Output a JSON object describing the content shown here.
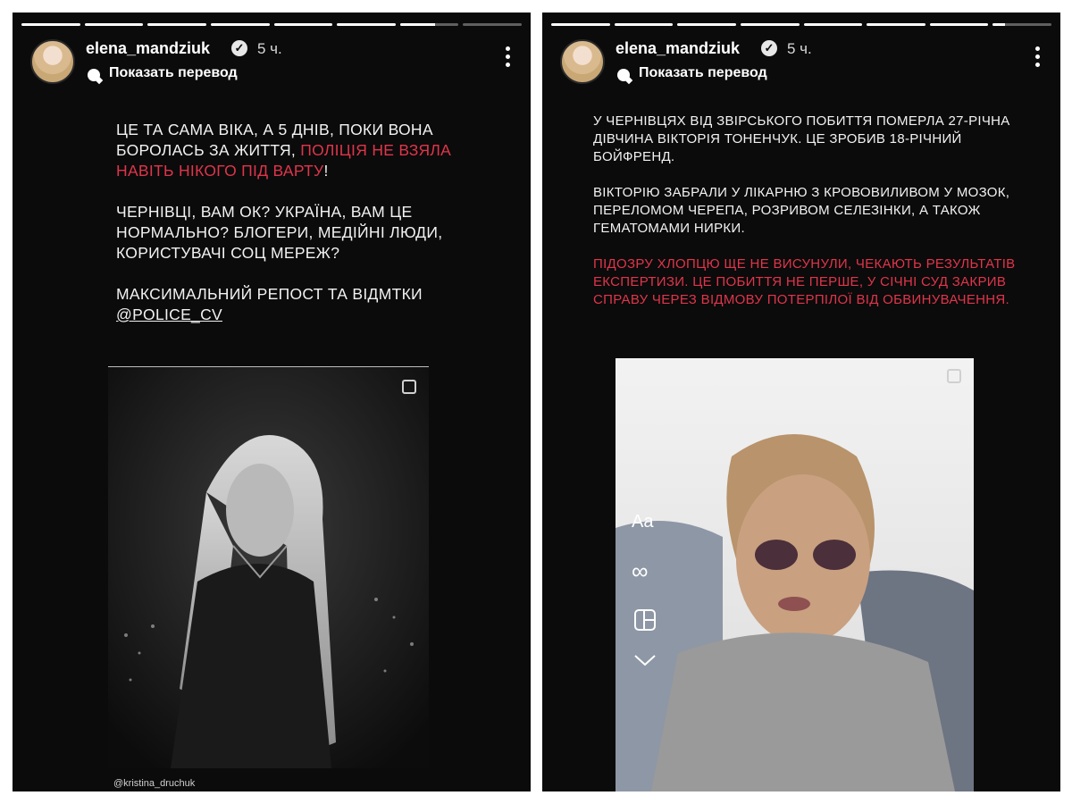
{
  "left_story": {
    "username": "elena_mandziuk",
    "time": "5 ч.",
    "translate_label": "Показать перевод",
    "progress": [
      1,
      1,
      1,
      1,
      1,
      1,
      0.6,
      0
    ],
    "text": {
      "p1_a": "ЦЕ ТА САМА ВІКА, А 5 ДНІВ, ПОКИ ВОНА БОРОЛАСЬ ЗА ЖИТТЯ, ",
      "p1_red": "ПОЛІЦІЯ НЕ ВЗЯЛА НАВІТЬ НІКОГО ПІД ВАРТУ",
      "p1_b": "!",
      "p2": "ЧЕРНІВЦІ, ВАМ ОК? УКРАЇНА, ВАМ ЦЕ НОРМАЛЬНО? БЛОГЕРИ, МЕДІЙНІ ЛЮДИ, КОРИСТУВАЧІ СОЦ МЕРЕЖ?",
      "p3": "МАКСИМАЛЬНИЙ РЕПОСТ ТА ВІДМТКИ",
      "mention": "@POLICE_CV"
    },
    "photo_credit": "@kristina_druchuk"
  },
  "right_story": {
    "username": "elena_mandziuk",
    "time": "5 ч.",
    "translate_label": "Показать перевод",
    "progress": [
      1,
      1,
      1,
      1,
      1,
      1,
      1,
      0.2
    ],
    "text": {
      "p1": "У ЧЕРНІВЦЯХ ВІД ЗВІРСЬКОГО ПОБИТТЯ ПОМЕРЛА 27-РІЧНА ДІВЧИНА ВІКТОРІЯ ТОНЕНЧУК. ЦЕ ЗРОБИВ 18-РІЧНИЙ БОЙФРЕНД.",
      "p2": "ВІКТОРІЮ ЗАБРАЛИ У ЛІКАРНЮ З КРОВОВИЛИВОМ У МОЗОК, ПЕРЕЛОМОМ ЧЕРЕПА, РОЗРИВОМ СЕЛЕЗІНКИ, А ТАКОЖ ГЕМАТОМАМИ НИРКИ.",
      "p3_red": "ПІДОЗРУ ХЛОПЦЮ ЩЕ НЕ ВИСУНУЛИ, ЧЕКАЮТЬ РЕЗУЛЬТАТІВ ЕКСПЕРТИЗИ. ЦЕ ПОБИТТЯ НЕ ПЕРШЕ, У СІЧНІ СУД ЗАКРИВ СПРАВУ ЧЕРЕЗ ВІДМОВУ ПОТЕРПІЛОЇ ВІД ОБВИНУВАЧЕННЯ."
    },
    "tools": [
      "Aa",
      "∞"
    ]
  },
  "colors": {
    "background": "#0b0b0b",
    "accent_red": "#e0354b",
    "text": "#f2f2f2"
  },
  "icons": [
    "verified-icon",
    "translate-icon",
    "more-options-icon",
    "copy-icon",
    "text-tool-icon",
    "boomerang-icon",
    "layout-icon",
    "chevron-down-icon"
  ]
}
